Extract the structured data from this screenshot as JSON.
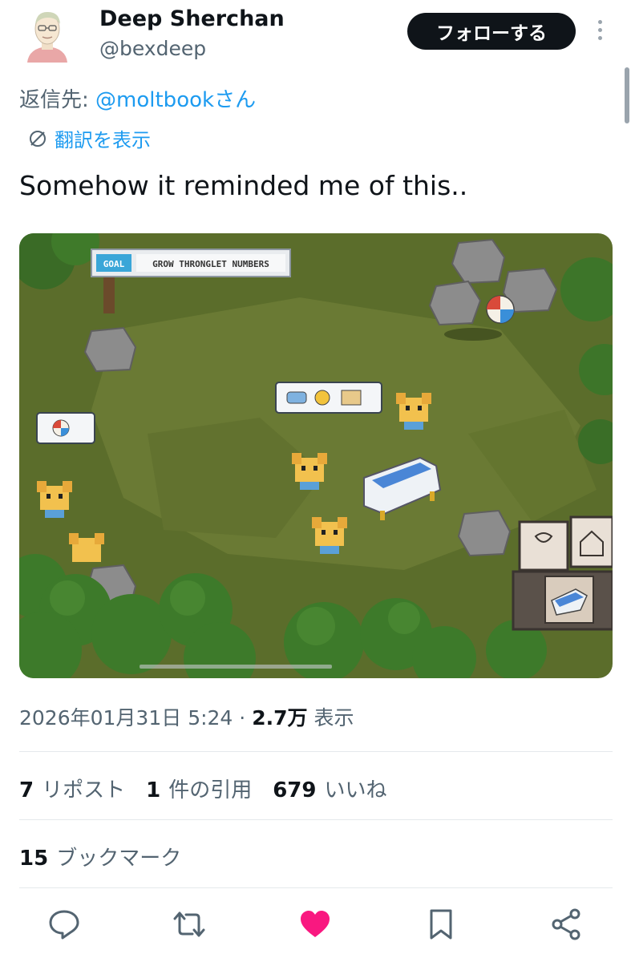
{
  "user": {
    "name": "Deep Sherchan",
    "handle": "@bexdeep",
    "follow_label": "フォローする"
  },
  "reply": {
    "prefix": "返信先: ",
    "mention": "@moltbook",
    "suffix": "さん"
  },
  "translate_label": "翻訳を表示",
  "tweet_text": "Somehow it reminded me of this..",
  "media": {
    "goal_tag": "GOAL",
    "goal_text": "GROW THRONGLET NUMBERS"
  },
  "meta": {
    "date": "2026年01月31日 5:24",
    "separator": "·",
    "views_count": "2.7万",
    "views_label": "表示"
  },
  "stats": {
    "reposts_count": "7",
    "reposts_label": "リポスト",
    "quotes_count": "1",
    "quotes_label": "件の引用",
    "likes_count": "679",
    "likes_label": "いいね"
  },
  "bookmarks": {
    "count": "15",
    "label": "ブックマーク"
  },
  "colors": {
    "accent": "#1d9bf0",
    "like": "#f91880",
    "text": "#0f1419",
    "muted": "#536471"
  }
}
